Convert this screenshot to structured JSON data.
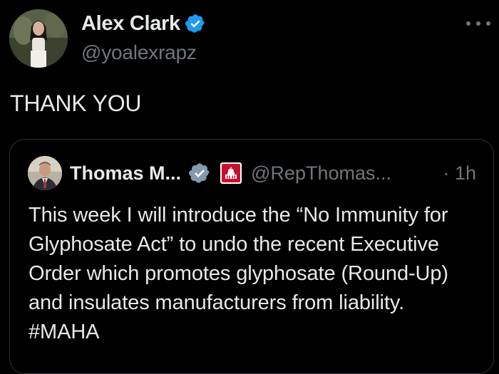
{
  "author": {
    "name": "Alex Clark",
    "handle": "@yoalexrapz",
    "verified_color": "#1d9bf0"
  },
  "tweet": {
    "text": "THANK YOU"
  },
  "quoted": {
    "name": "Thomas M...",
    "handle": "@RepThomas...",
    "time": "· 1h",
    "verified_color": "#829aab",
    "text": "This week I will introduce the “No Immunity for Glyphosate Act” to undo the recent Executive Order which promotes glyphosate (Round-Up) and insulates manufacturers from liability. #MAHA"
  },
  "icons": {
    "more": "more-horizontal-icon",
    "verified": "verified-badge-icon",
    "affiliation": "us-capitol-flag-icon"
  },
  "colors": {
    "background": "#000000",
    "text": "#e7e9ea",
    "muted": "#71767b",
    "border": "#2f3336"
  }
}
